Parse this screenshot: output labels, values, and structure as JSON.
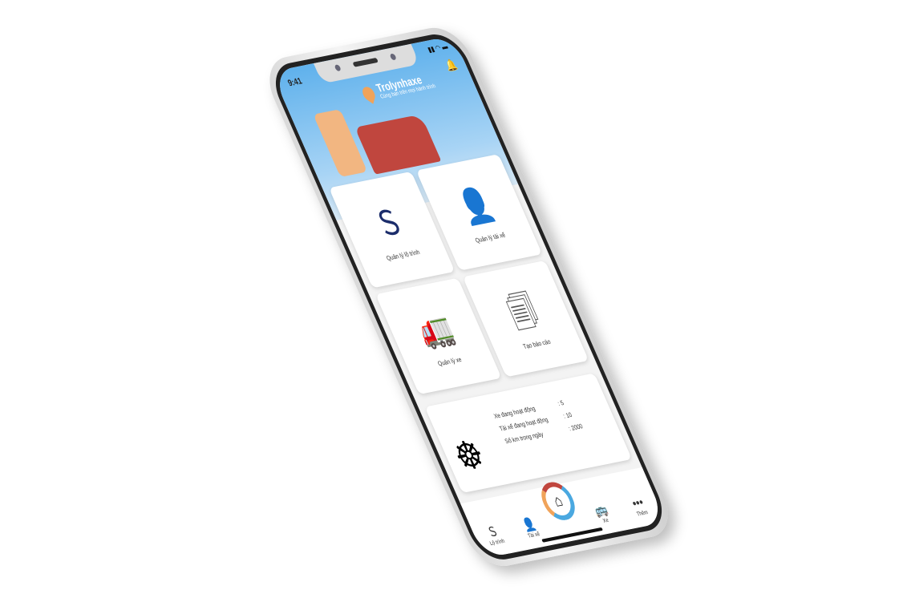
{
  "status_bar": {
    "time": "9:41"
  },
  "header": {
    "title": "Trolynhaxe",
    "subtitle": "Cùng bạn trên mọi hành trình"
  },
  "cards": [
    {
      "label": "Quản lý lộ trình",
      "icon": "road-icon"
    },
    {
      "label": "Quản lý tài xế",
      "icon": "driver-icon"
    },
    {
      "label": "Quản lý xe",
      "icon": "truck-icon"
    },
    {
      "label": "Tạo báo cáo",
      "icon": "documents-icon"
    }
  ],
  "stats": [
    {
      "label": "Xe đang hoạt động",
      "value": ": 5"
    },
    {
      "label": "Tài xế đang hoạt động",
      "value": ": 10"
    },
    {
      "label": "Số km trong ngày",
      "value": ": 2000"
    }
  ],
  "nav": [
    {
      "label": "Lộ trình"
    },
    {
      "label": "Tài xế"
    },
    {
      "label": "Xe"
    },
    {
      "label": "Thêm"
    }
  ],
  "colors": {
    "brand_red": "#c0463e",
    "brand_blue": "#4aa8e0",
    "brand_orange": "#f0a35a"
  }
}
